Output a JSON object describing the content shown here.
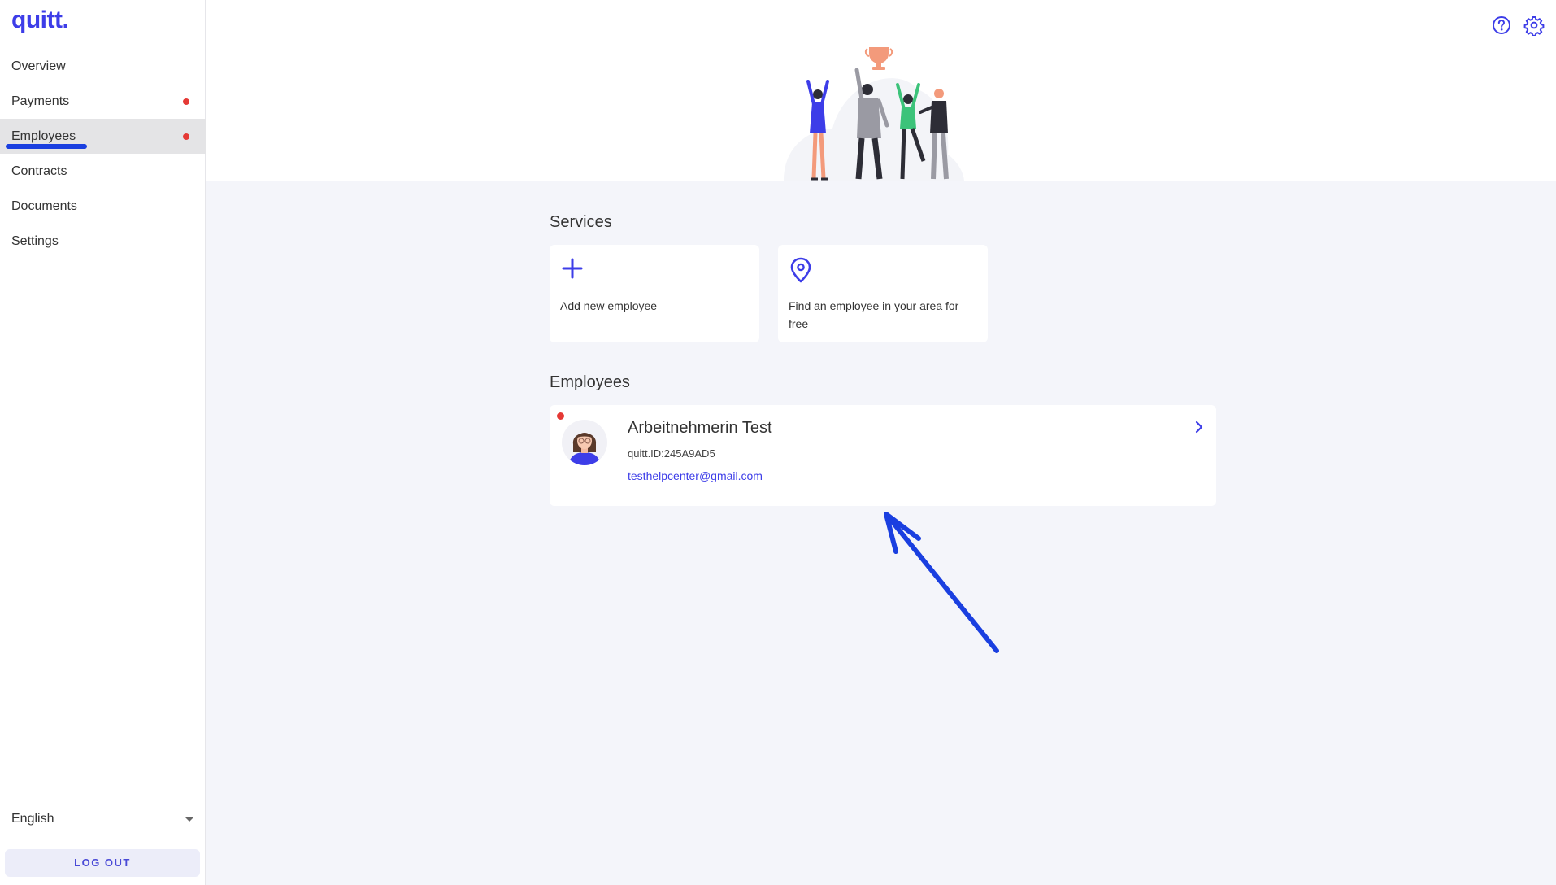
{
  "app": {
    "logo_text": "quitt."
  },
  "sidebar": {
    "items": [
      {
        "label": "Overview",
        "badge": false
      },
      {
        "label": "Payments",
        "badge": true
      },
      {
        "label": "Employees",
        "badge": true,
        "active": true
      },
      {
        "label": "Contracts",
        "badge": false
      },
      {
        "label": "Documents",
        "badge": false
      },
      {
        "label": "Settings",
        "badge": false
      }
    ],
    "language": "English",
    "logout_label": "LOG OUT"
  },
  "header": {
    "icons": [
      "help-icon",
      "gear-icon"
    ]
  },
  "services": {
    "title": "Services",
    "cards": [
      {
        "label": "Add new employee",
        "icon": "plus-icon"
      },
      {
        "label": "Find an employee in your area for free",
        "icon": "location-pin-icon"
      }
    ]
  },
  "employees": {
    "title": "Employees",
    "list": [
      {
        "name": "Arbeitnehmerin Test",
        "quitt_id": "quitt.ID:245A9AD5",
        "email": "testhelpcenter@gmail.com",
        "unread": true
      }
    ]
  },
  "colors": {
    "accent": "#3d3de8",
    "badge": "#e53935",
    "annotation": "#1a3fe0",
    "background": "#f4f5fa"
  }
}
